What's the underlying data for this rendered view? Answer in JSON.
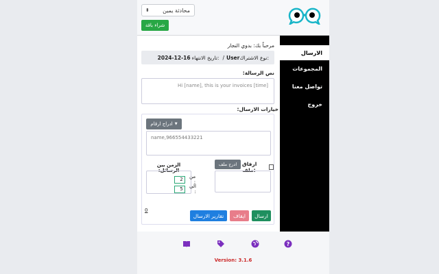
{
  "header": {
    "dialect_value": "محادثة يمين",
    "buy_label": "شراء باقة",
    "logo_icon": "chat-bubbles-logo",
    "colors": {
      "buy": "#28a745",
      "logo_teal": "#19b5c8"
    }
  },
  "sidebar": {
    "items": [
      {
        "label": "الارسال",
        "active": true
      },
      {
        "label": "المجموعات",
        "active": false
      },
      {
        "label": "تواصل معنا",
        "active": false
      },
      {
        "label": "خروج",
        "active": false
      }
    ]
  },
  "main": {
    "welcome": "مرحباً بك: بدوي النجار",
    "subscription": {
      "prefix": "نوع الاشتراك:",
      "type": "User",
      "separator": "/",
      "expiry_label": "تاريخ الانتهاء:",
      "expiry_date": "2024-12-16"
    },
    "message_label": "نص الرسالة:",
    "message_value": "Hi [name], this is your invoices [time]",
    "options_label": "خيارات الارسال:",
    "insert_numbers_label": "ادراج ارقام",
    "numbers_value": "name,966554433221",
    "attach_label": "ارفاق ملف:",
    "add_file_label": "ادرج ملف",
    "time_label": "الزمن بين الرسائل:",
    "from_label": "من :",
    "from_value": "2",
    "to_label": "الى :",
    "to_value": "5",
    "counter": "0",
    "send_label": "ارسال",
    "stop_label": "ايقاف",
    "reports_label": "تقارير الارسال",
    "colors": {
      "send": "#1f8f5f",
      "stop": "#e87d8a",
      "reports": "#1f7fe0"
    }
  },
  "footer": {
    "icons": [
      "book-icon",
      "tags-icon",
      "globe-icon",
      "help-icon"
    ],
    "version": "Version: 3.1.6",
    "icon_color": "#7b2fbe"
  }
}
